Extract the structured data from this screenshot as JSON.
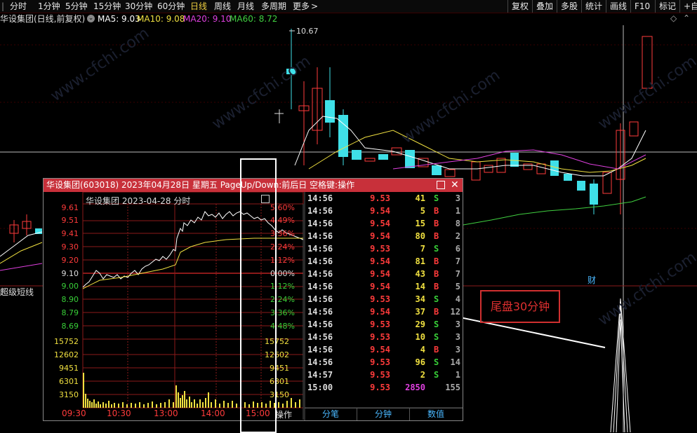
{
  "toolbar": {
    "periods": [
      "分时",
      "1分钟",
      "5分钟",
      "15分钟",
      "30分钟",
      "60分钟",
      "日线",
      "周线",
      "月线",
      "多周期",
      "更多"
    ],
    "active_period": "日线",
    "more_glyph": ">",
    "right_buttons": [
      "复权",
      "叠加",
      "多股",
      "统计",
      "画线",
      "F10",
      "标记",
      "+自选"
    ]
  },
  "ma_bar": {
    "stock_title": "华设集团(日线,前复权)",
    "ma5": "MA5: 9.03",
    "ma10": "MA10: 9.08",
    "ma20": "MA20: 9.10",
    "ma60": "MA60: 8.72",
    "colors": {
      "ma5": "#ffffff",
      "ma10": "#f0e040",
      "ma20": "#e040e0",
      "ma60": "#40d040"
    }
  },
  "kline": {
    "high_label": "10.67",
    "caitou_label": "财",
    "indicator_label": "超级短线"
  },
  "watermark": "www.cfchi.com",
  "popup": {
    "title": "华设集团(603018) 2023年04月28日 星期五 PageUp/Down:前后日 空格键:操作",
    "chart_title": "华设集团  2023-04-28 分时",
    "price_labels": [
      "9.61",
      "9.51",
      "9.41",
      "9.30",
      "9.20",
      "9.10",
      "9.00",
      "8.90",
      "8.79",
      "8.69"
    ],
    "pct_labels": [
      "5.60%",
      "4.49%",
      "3.36%",
      "2.24%",
      "1.12%",
      "0.00%",
      "1.12%",
      "2.24%",
      "3.36%",
      "4.48%"
    ],
    "vol_labels_left": [
      "15752",
      "12602",
      "9451",
      "6301",
      "3150"
    ],
    "vol_labels_right": [
      "15752",
      "12602",
      "9451",
      "6301",
      "3150"
    ],
    "time_labels": [
      "09:30",
      "10:30",
      "13:00",
      "14:00",
      "15:00"
    ],
    "op_label": "操作",
    "trades": [
      {
        "time": "14:56",
        "price": "9.53",
        "vol": "41",
        "side": "S",
        "n": "3"
      },
      {
        "time": "14:56",
        "price": "9.54",
        "vol": "5",
        "side": "B",
        "n": "1"
      },
      {
        "time": "14:56",
        "price": "9.54",
        "vol": "15",
        "side": "B",
        "n": "8"
      },
      {
        "time": "14:56",
        "price": "9.54",
        "vol": "80",
        "side": "B",
        "n": "2"
      },
      {
        "time": "14:56",
        "price": "9.53",
        "vol": "7",
        "side": "S",
        "n": "6"
      },
      {
        "time": "14:56",
        "price": "9.54",
        "vol": "81",
        "side": "B",
        "n": "7"
      },
      {
        "time": "14:56",
        "price": "9.54",
        "vol": "43",
        "side": "B",
        "n": "7"
      },
      {
        "time": "14:56",
        "price": "9.54",
        "vol": "14",
        "side": "B",
        "n": "5"
      },
      {
        "time": "14:56",
        "price": "9.53",
        "vol": "34",
        "side": "S",
        "n": "4"
      },
      {
        "time": "14:56",
        "price": "9.54",
        "vol": "37",
        "side": "B",
        "n": "12"
      },
      {
        "time": "14:56",
        "price": "9.53",
        "vol": "29",
        "side": "S",
        "n": "3"
      },
      {
        "time": "14:56",
        "price": "9.53",
        "vol": "10",
        "side": "S",
        "n": "3"
      },
      {
        "time": "14:56",
        "price": "9.54",
        "vol": "4",
        "side": "B",
        "n": "3"
      },
      {
        "time": "14:56",
        "price": "9.53",
        "vol": "96",
        "side": "S",
        "n": "14"
      },
      {
        "time": "14:57",
        "price": "9.53",
        "vol": "2",
        "side": "S",
        "n": "1"
      },
      {
        "time": "15:00",
        "price": "9.53",
        "vol": "2850",
        "side": "",
        "n": "155"
      }
    ],
    "tabs": [
      "分笔",
      "分钟",
      "数值"
    ]
  },
  "annotation": "尾盘30分钟",
  "colors": {
    "up": "#ff3b3b",
    "down": "#3fe0e8",
    "grid": "#8b1a1a",
    "green": "#38d038",
    "yellow": "#f0e040",
    "magenta": "#e040e0"
  }
}
